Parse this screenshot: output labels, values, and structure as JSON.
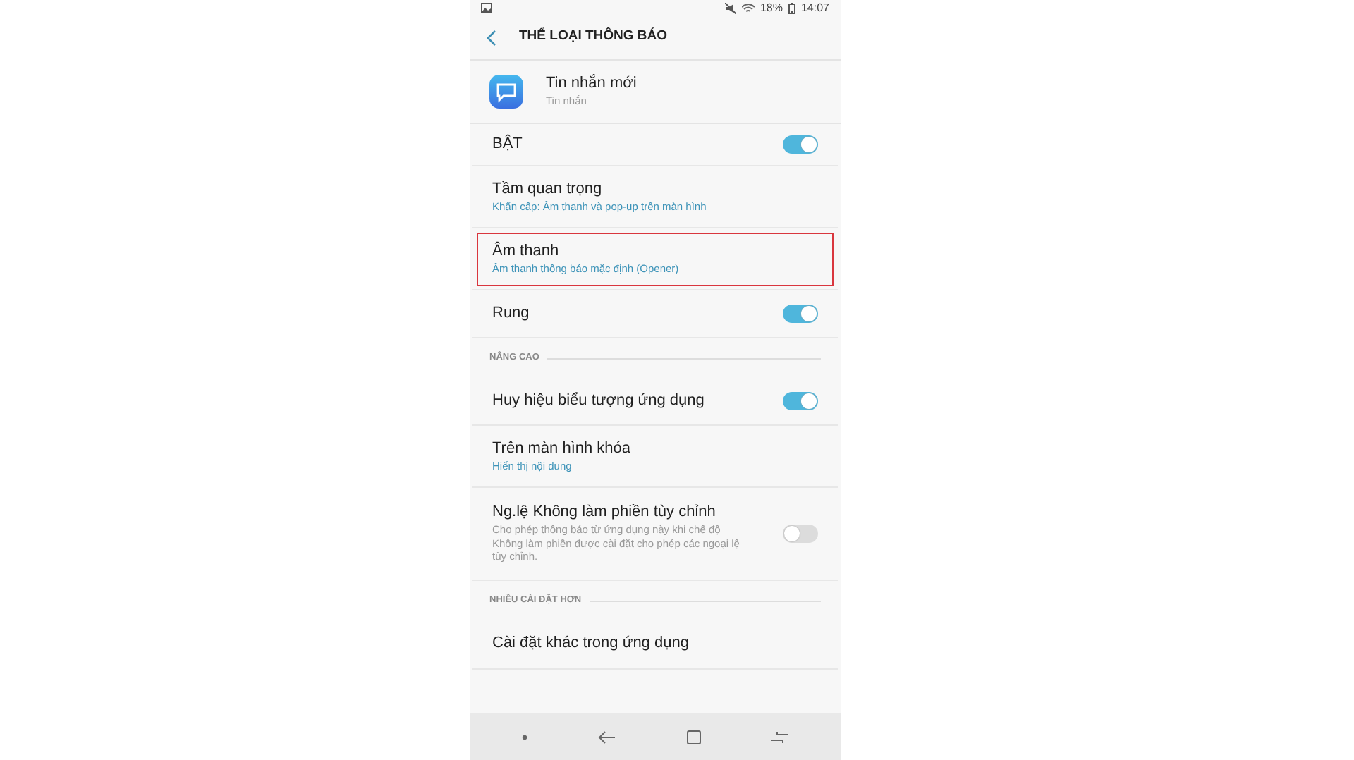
{
  "status_bar": {
    "battery": "18%",
    "time": "14:07"
  },
  "header": {
    "title": "THỂ LOẠI THÔNG BÁO"
  },
  "app": {
    "name": "Tin nhắn mới",
    "subtitle": "Tin nhắn"
  },
  "items": [
    {
      "kind": "toggle",
      "title": "BẬT",
      "on": true,
      "highlighted": false
    },
    {
      "kind": "link",
      "title": "Tầm quan trọng",
      "subtitle": "Khẩn cấp: Âm thanh và pop-up trên màn hình",
      "highlighted": false
    },
    {
      "kind": "link",
      "title": "Âm thanh",
      "subtitle": "Âm thanh thông báo mặc định (Opener)",
      "highlighted": true
    },
    {
      "kind": "toggle",
      "title": "Rung",
      "on": true,
      "highlighted": false
    },
    {
      "kind": "section",
      "title": "NÂNG CAO"
    },
    {
      "kind": "toggle",
      "title": "Huy hiệu biểu tượng ứng dụng",
      "on": true,
      "highlighted": false
    },
    {
      "kind": "link",
      "title": "Trên màn hình khóa",
      "subtitle": "Hiển thị nội dung",
      "highlighted": false
    },
    {
      "kind": "toggle",
      "title": "Ng.lệ Không làm phiền tùy chỉnh",
      "subtitle": "Cho phép thông báo từ ứng dụng này khi chế độ Không làm phiền được cài đặt cho phép các ngoại lệ tùy chỉnh.",
      "on": false,
      "highlighted": false
    },
    {
      "kind": "section",
      "title": "NHIỀU CÀI ĐẶT HƠN"
    },
    {
      "kind": "link",
      "title": "Cài đặt khác trong ứng dụng",
      "highlighted": false
    }
  ]
}
